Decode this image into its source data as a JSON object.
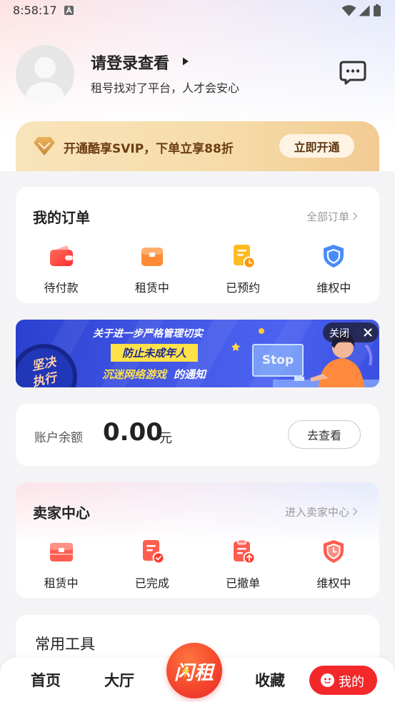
{
  "status_bar": {
    "time": "8:58:17",
    "icons": [
      "a-notification-icon",
      "wifi-icon",
      "signal-icon",
      "battery-icon"
    ]
  },
  "profile": {
    "login_prompt": "请登录查看",
    "tagline": "租号找对了平台，人才会安心",
    "avatar_icon": "default-avatar-icon",
    "message_icon": "message-icon"
  },
  "vip_banner": {
    "text": "开通酷享SVIP，下单立享88折",
    "button_label": "立即开通",
    "icon": "diamond-icon"
  },
  "orders": {
    "title": "我的订单",
    "all_link": "全部订单",
    "items": [
      {
        "label": "待付款",
        "icon": "wallet-icon"
      },
      {
        "label": "租赁中",
        "icon": "box-icon"
      },
      {
        "label": "已预约",
        "icon": "reservation-icon"
      },
      {
        "label": "维权中",
        "icon": "shield-icon"
      }
    ]
  },
  "ad_banner": {
    "line1": "关于进一步严格管理切实",
    "line2": "防止未成年人",
    "line3_highlight": "沉迷网络游戏",
    "line3_rest": "的通知",
    "badge_line1": "坚决",
    "badge_line2": "执行",
    "monitor_text": "Stop",
    "close_label": "关闭"
  },
  "balance": {
    "label": "账户余额",
    "amount": "0.00",
    "unit": "元",
    "button_label": "去查看"
  },
  "seller": {
    "title": "卖家中心",
    "link": "进入卖家中心",
    "items": [
      {
        "label": "租赁中",
        "icon": "box-icon"
      },
      {
        "label": "已完成",
        "icon": "completed-doc-icon"
      },
      {
        "label": "已撤单",
        "icon": "withdrawn-clipboard-icon"
      },
      {
        "label": "维权中",
        "icon": "shield-clock-icon"
      }
    ]
  },
  "tools": {
    "title": "常用工具"
  },
  "bottom_nav": {
    "home": "首页",
    "hall": "大厅",
    "logo": "闪租",
    "favorites": "收藏",
    "mine": "我的",
    "active": "我的"
  },
  "colors": {
    "accent_red": "#f3282b",
    "vip_text": "#6b3c12",
    "vip_gold": "#f6dcaa",
    "ad_blue": "#4256e6",
    "ad_yellow": "#ffe14a",
    "page_bg": "#f4f4f6"
  }
}
